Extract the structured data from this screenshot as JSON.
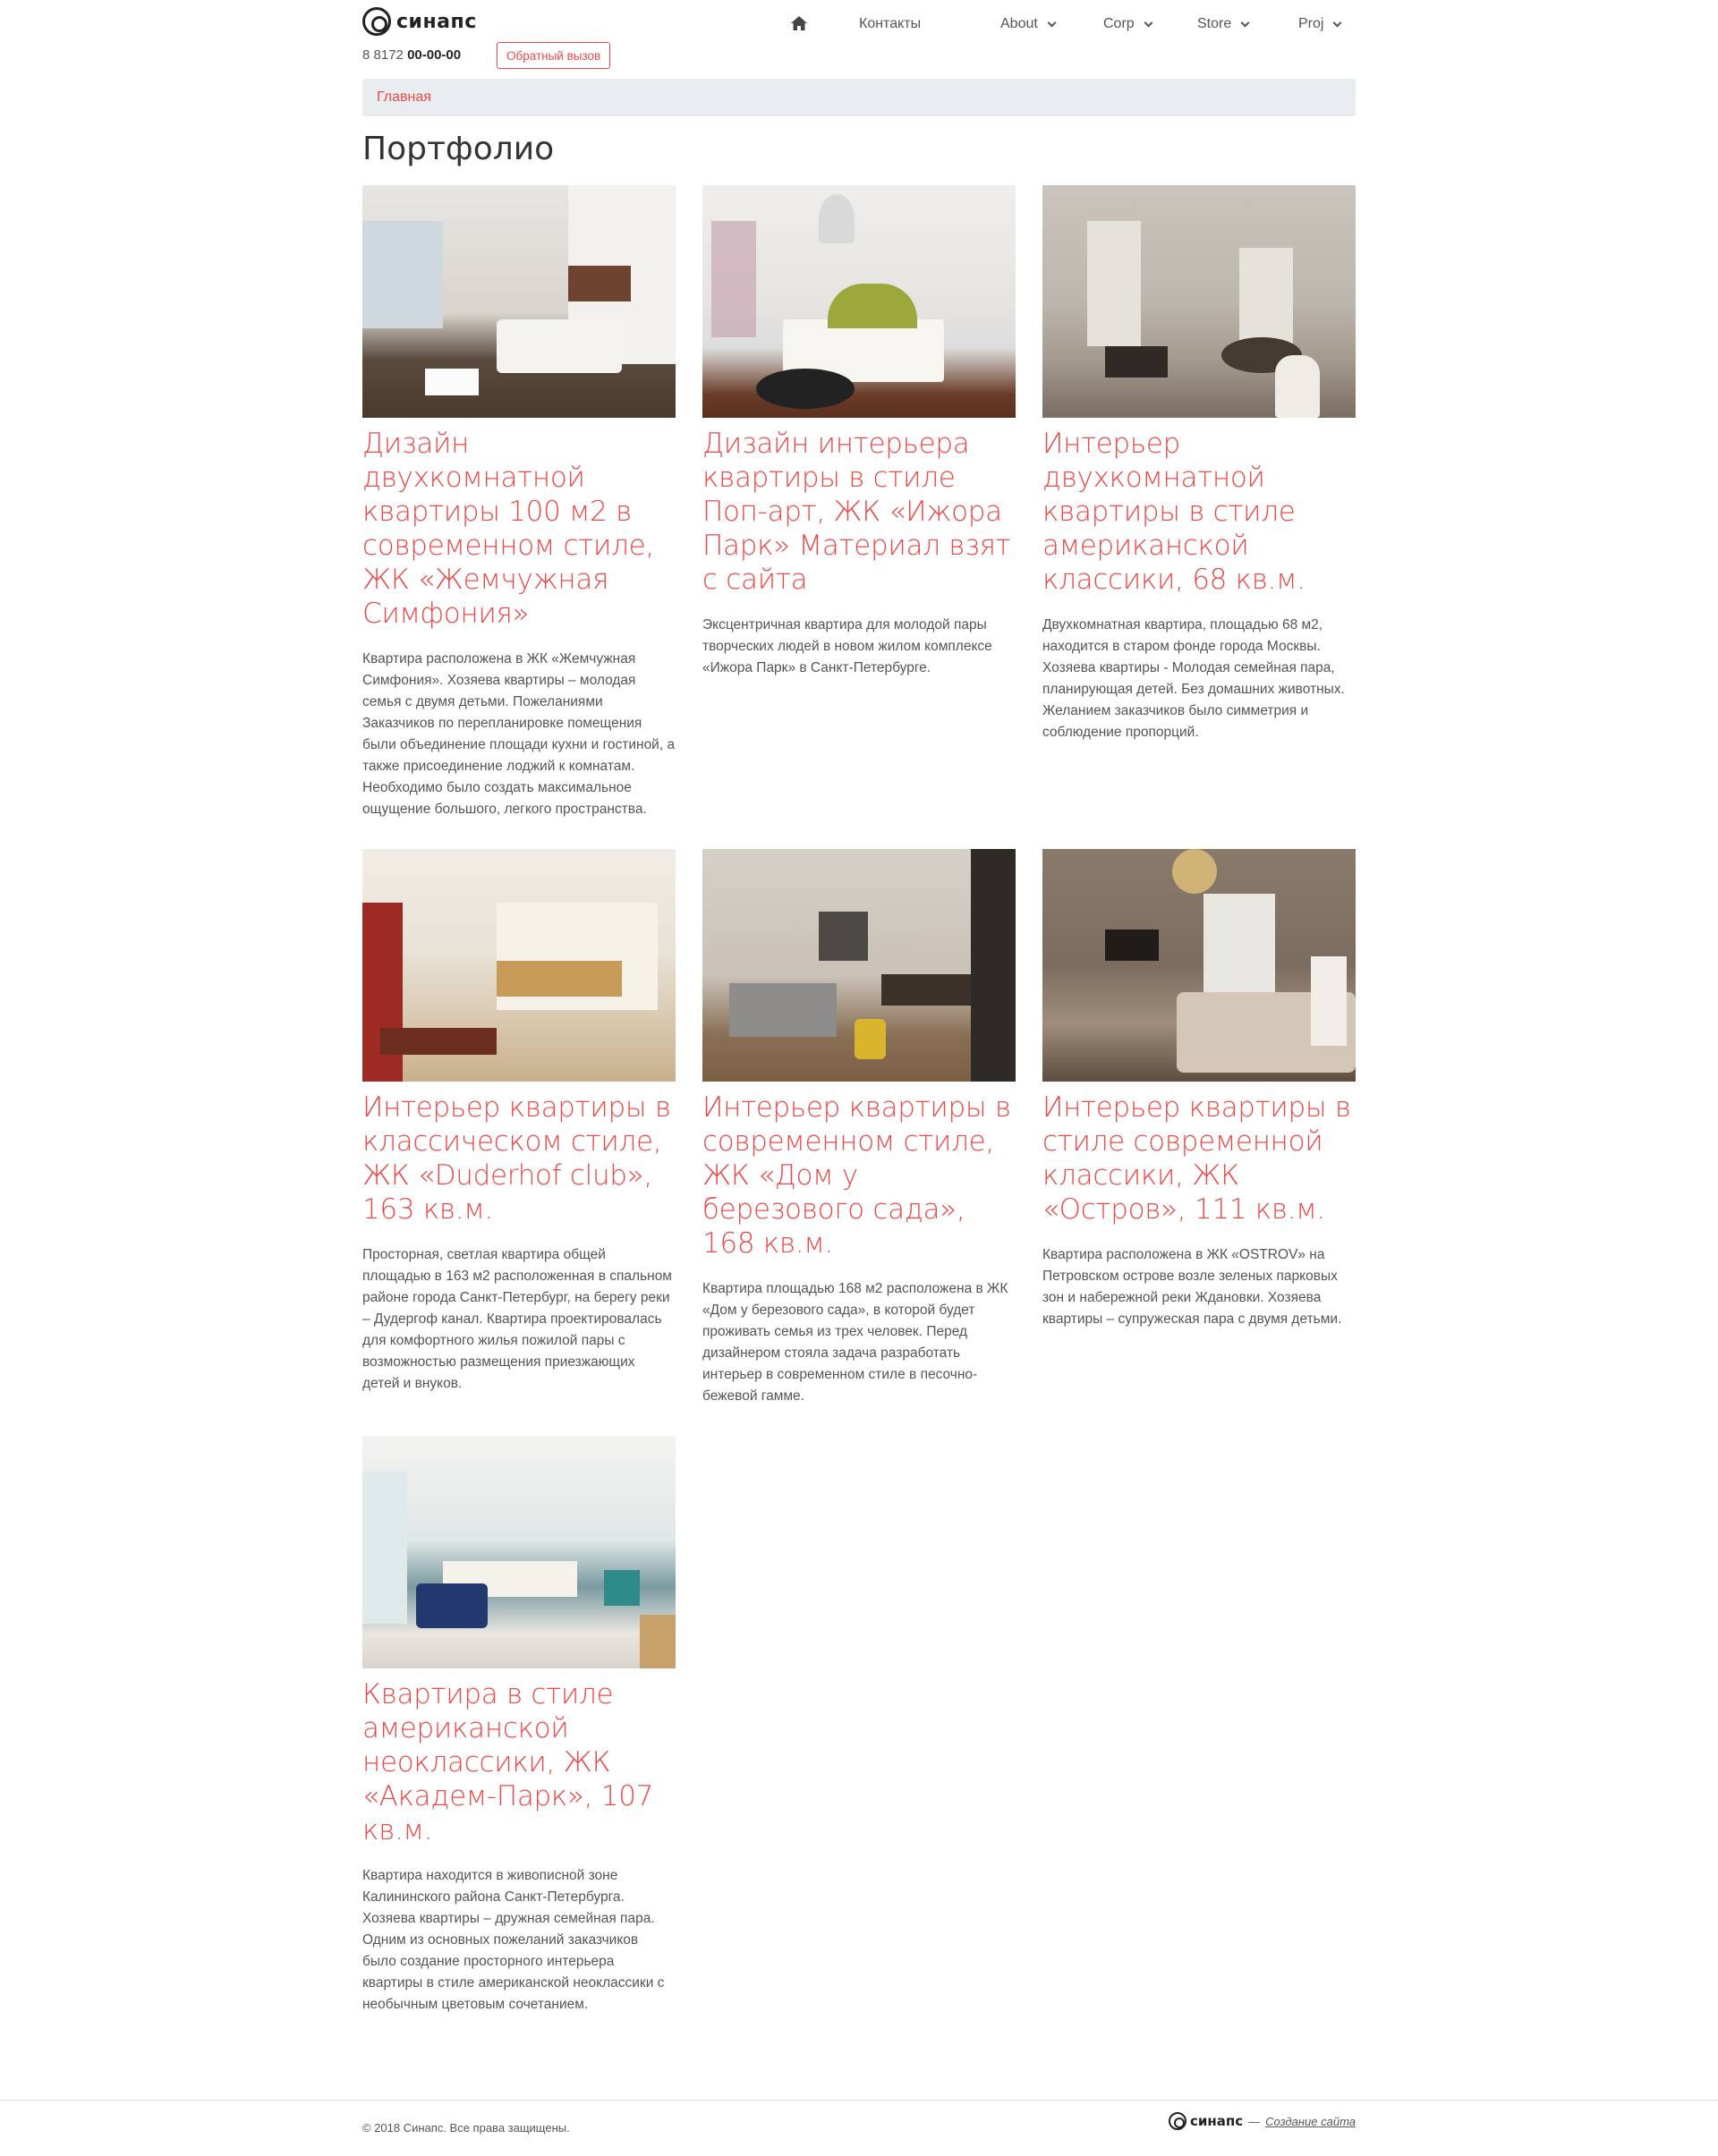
{
  "header": {
    "logo_text": "синапс",
    "phone_prefix": "8 8172",
    "phone_number": "00-00-00",
    "callback_label": "Обратный вызов"
  },
  "nav": {
    "home_icon": "home-icon",
    "items": [
      {
        "label": "Контакты"
      },
      {
        "label": "About"
      },
      {
        "label": "Corp"
      },
      {
        "label": "Store"
      },
      {
        "label": "Proj"
      }
    ]
  },
  "breadcrumb": {
    "home": "Главная"
  },
  "page": {
    "title": "Портфолио"
  },
  "cards": [
    {
      "title": "Дизайн двухкомнатной квартиры 100 м2 в современном стиле, ЖК «Жемчужная Симфония»",
      "text": "Квартира расположена в ЖК «Жемчужная Симфония». Хозяева квартиры – молодая семья с двумя детьми. Пожеланиями Заказчиков по перепланировке помещения были объединение площади кухни и гостиной, а также присоединение лоджий к комнатам. Необходимо было создать максимальное ощущение большого, легкого пространства."
    },
    {
      "title": "Дизайн интерьера квартиры в стиле Поп-арт, ЖК «Ижора Парк» Материал взят с сайта",
      "text": "Эксцентричная квартира для молодой пары творческих людей в новом жилом комплексе «Ижора Парк» в Санкт-Петербурге."
    },
    {
      "title": "Интерьер двухкомнатной квартиры в стиле американской классики, 68 кв.м.",
      "text": "Двухкомнатная квартира, площадью 68 м2, находится в старом фонде города Москвы. Хозяева квартиры - Молодая семейная пара, планирующая детей. Без домашних животных. Желанием заказчиков было симметрия и соблюдение пропорций."
    },
    {
      "title": "Интерьер квартиры в классическом стиле, ЖК «Duderhof club», 163 кв.м.",
      "text": "Просторная, светлая квартира общей площадью в 163 м2 расположенная в спальном районе города Санкт-Петербург, на берегу реки – Дудергоф канал. Квартира проектировалась для комфортного жилья пожилой пары с возможностью размещения приезжающих детей и внуков."
    },
    {
      "title": "Интерьер квартиры в современном стиле, ЖК «Дом у березового сада», 168 кв.м.",
      "text": "Квартира площадью 168 м2 расположена в ЖК «Дом у березового сада», в которой будет проживать семья из трех человек. Перед дизайнером стояла задача разработать интерьер в современном стиле в песочно-бежевой гамме."
    },
    {
      "title": "Интерьер квартиры в стиле современной классики, ЖК «Остров», 111 кв.м.",
      "text": "Квартира расположена в ЖК «OSTROV» на Петровском острове возле зеленых парковых зон и набережной реки Ждановки. Хозяева квартиры – супружеская пара с двумя детьми."
    },
    {
      "title": "Квартира в стиле американской неоклассики, ЖК «Академ-Парк», 107 кв.м.",
      "text": "Квартира находится в живописной зоне Калининского района Санкт-Петербурга. Хозяева квартиры – дружная семейная пара. Одним из основных пожеланий заказчиков было создание просторного интерьера квартиры в стиле американской неоклассики с необычным цветовым сочетанием."
    }
  ],
  "footer": {
    "copyright": "© 2018 Синапс. Все права защищены.",
    "logo_text": "синапс",
    "dash": "—",
    "link": "Создание сайта"
  },
  "colors": {
    "accent": "#e84a4a",
    "breadcrumb_bg": "#e9ecef"
  }
}
